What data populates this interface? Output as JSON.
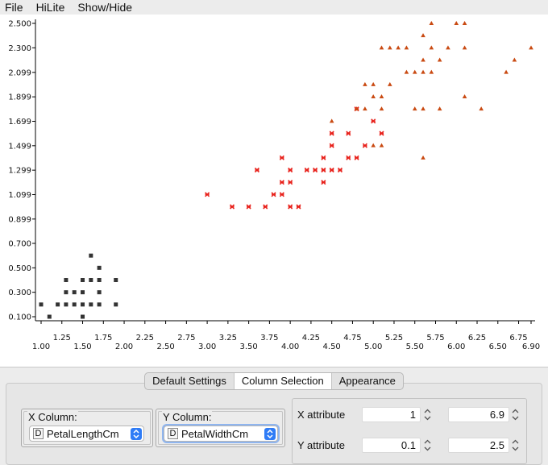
{
  "menu": [
    "File",
    "HiLite",
    "Show/Hide"
  ],
  "chart_data": {
    "type": "scatter",
    "xlabel": "",
    "ylabel": "",
    "xlim": [
      1.0,
      6.9
    ],
    "ylim": [
      0.1,
      2.5
    ],
    "x_ticks_upper": [
      "1.25",
      "1.75",
      "2.25",
      "2.75",
      "3.25",
      "3.75",
      "4.25",
      "4.75",
      "5.25",
      "5.75",
      "6.25",
      "6.75"
    ],
    "x_ticks_lower": [
      "1.00",
      "1.50",
      "2.00",
      "2.50",
      "3.00",
      "3.50",
      "4.00",
      "4.50",
      "5.00",
      "5.50",
      "6.00",
      "6.50",
      "6.90"
    ],
    "y_ticks": [
      "2.500",
      "2.300",
      "2.099",
      "1.899",
      "1.699",
      "1.499",
      "1.299",
      "1.099",
      "0.899",
      "0.700",
      "0.500",
      "0.300",
      "0.100"
    ],
    "series": [
      {
        "marker": "square",
        "color": "#333333",
        "points": [
          [
            1.0,
            0.2
          ],
          [
            1.1,
            0.1
          ],
          [
            1.2,
            0.2
          ],
          [
            1.3,
            0.2
          ],
          [
            1.3,
            0.3
          ],
          [
            1.3,
            0.4
          ],
          [
            1.4,
            0.2
          ],
          [
            1.4,
            0.3
          ],
          [
            1.5,
            0.1
          ],
          [
            1.5,
            0.2
          ],
          [
            1.5,
            0.3
          ],
          [
            1.5,
            0.4
          ],
          [
            1.6,
            0.2
          ],
          [
            1.6,
            0.4
          ],
          [
            1.6,
            0.6
          ],
          [
            1.7,
            0.2
          ],
          [
            1.7,
            0.3
          ],
          [
            1.7,
            0.4
          ],
          [
            1.7,
            0.5
          ],
          [
            1.9,
            0.2
          ],
          [
            1.9,
            0.4
          ]
        ]
      },
      {
        "marker": "x",
        "color": "#e8231d",
        "points": [
          [
            3.0,
            1.1
          ],
          [
            3.3,
            1.0
          ],
          [
            3.5,
            1.0
          ],
          [
            3.6,
            1.3
          ],
          [
            3.7,
            1.0
          ],
          [
            3.8,
            1.1
          ],
          [
            3.9,
            1.1
          ],
          [
            3.9,
            1.2
          ],
          [
            3.9,
            1.4
          ],
          [
            4.0,
            1.0
          ],
          [
            4.0,
            1.2
          ],
          [
            4.0,
            1.3
          ],
          [
            4.1,
            1.0
          ],
          [
            4.2,
            1.3
          ],
          [
            4.3,
            1.3
          ],
          [
            4.4,
            1.2
          ],
          [
            4.4,
            1.3
          ],
          [
            4.4,
            1.4
          ],
          [
            4.5,
            1.3
          ],
          [
            4.5,
            1.5
          ],
          [
            4.5,
            1.6
          ],
          [
            4.6,
            1.3
          ],
          [
            4.7,
            1.4
          ],
          [
            4.7,
            1.6
          ],
          [
            4.8,
            1.4
          ],
          [
            4.8,
            1.8
          ],
          [
            4.9,
            1.5
          ],
          [
            5.0,
            1.7
          ],
          [
            5.1,
            1.6
          ]
        ]
      },
      {
        "marker": "triangle",
        "color": "#c94a12",
        "points": [
          [
            4.5,
            1.7
          ],
          [
            4.8,
            1.8
          ],
          [
            4.9,
            1.8
          ],
          [
            4.9,
            2.0
          ],
          [
            5.0,
            1.5
          ],
          [
            5.0,
            1.9
          ],
          [
            5.0,
            2.0
          ],
          [
            5.1,
            1.5
          ],
          [
            5.1,
            1.8
          ],
          [
            5.1,
            1.9
          ],
          [
            5.1,
            2.3
          ],
          [
            5.2,
            2.0
          ],
          [
            5.2,
            2.3
          ],
          [
            5.3,
            2.3
          ],
          [
            5.4,
            2.1
          ],
          [
            5.4,
            2.3
          ],
          [
            5.5,
            1.8
          ],
          [
            5.5,
            2.1
          ],
          [
            5.6,
            1.4
          ],
          [
            5.6,
            1.8
          ],
          [
            5.6,
            2.1
          ],
          [
            5.6,
            2.2
          ],
          [
            5.6,
            2.4
          ],
          [
            5.7,
            2.1
          ],
          [
            5.7,
            2.3
          ],
          [
            5.7,
            2.5
          ],
          [
            5.8,
            1.8
          ],
          [
            5.8,
            2.2
          ],
          [
            5.9,
            2.3
          ],
          [
            6.0,
            2.5
          ],
          [
            6.1,
            1.9
          ],
          [
            6.1,
            2.3
          ],
          [
            6.1,
            2.5
          ],
          [
            6.3,
            1.8
          ],
          [
            6.6,
            2.1
          ],
          [
            6.7,
            2.2
          ],
          [
            6.9,
            2.3
          ]
        ]
      }
    ]
  },
  "tabs": {
    "default_settings": "Default Settings",
    "column_selection": "Column Selection",
    "appearance": "Appearance"
  },
  "x_column": {
    "label": "X Column:",
    "type_badge": "D",
    "value": "PetalLengthCm"
  },
  "y_column": {
    "label": "Y Column:",
    "type_badge": "D",
    "value": "PetalWidthCm"
  },
  "x_attribute": {
    "label": "X attribute",
    "min": "1",
    "max": "6.9"
  },
  "y_attribute": {
    "label": "Y attribute",
    "min": "0.1",
    "max": "2.5"
  }
}
